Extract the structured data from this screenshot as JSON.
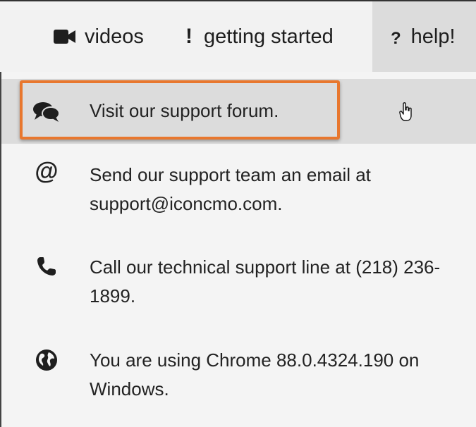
{
  "nav": {
    "videos": {
      "label": "videos",
      "icon": "video-camera-icon"
    },
    "getting_started": {
      "label": "getting started",
      "icon": "exclamation-icon"
    },
    "help": {
      "label": "help!",
      "icon": "question-icon"
    }
  },
  "help_menu": {
    "items": [
      {
        "icon": "chat-bubbles-icon",
        "text": "Visit our support forum."
      },
      {
        "icon": "at-sign-icon",
        "text": "Send our support team an email at support@iconcmo.com."
      },
      {
        "icon": "phone-icon",
        "text": "Call our technical support line at (218) 236-1899."
      },
      {
        "icon": "globe-icon",
        "text": "You are using Chrome 88.0.4324.190 on Windows."
      }
    ]
  },
  "glyphs": {
    "bang": "!",
    "question": "?",
    "at": "@"
  },
  "colors": {
    "highlight": "#e8772e",
    "active_bg": "#dcdcdc",
    "background": "#f2f2f2",
    "text": "#222222"
  }
}
